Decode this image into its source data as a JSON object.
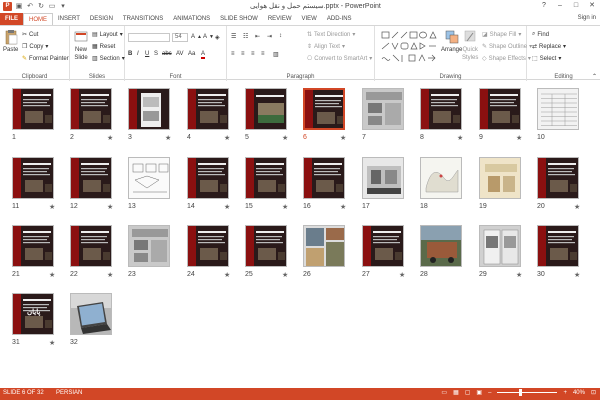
{
  "titlebar": {
    "title": "سیستم حمل و نقل هوایی.pptx - PowerPoint",
    "logo": "P",
    "controls": [
      "?",
      "–",
      "□",
      "✕"
    ]
  },
  "tabs": [
    {
      "label": "FILE"
    },
    {
      "label": "HOME"
    },
    {
      "label": "INSERT"
    },
    {
      "label": "DESIGN"
    },
    {
      "label": "TRANSITIONS"
    },
    {
      "label": "ANIMATIONS"
    },
    {
      "label": "SLIDE SHOW"
    },
    {
      "label": "REVIEW"
    },
    {
      "label": "VIEW"
    },
    {
      "label": "ADD-INS"
    }
  ],
  "signin": "Sign in",
  "ribbon": {
    "clipboard": {
      "label": "Clipboard",
      "paste": "Paste",
      "cut": "Cut",
      "copy": "Copy",
      "format_painter": "Format Painter"
    },
    "slides": {
      "label": "Slides",
      "new_slide": "New",
      "new_slide2": "Slide",
      "layout": "Layout",
      "reset": "Reset",
      "section": "Section"
    },
    "font": {
      "label": "Font",
      "size": "54"
    },
    "paragraph": {
      "label": "Paragraph",
      "text_direction": "Text Direction",
      "align_text": "Align Text",
      "convert_smartart": "Convert to SmartArt"
    },
    "drawing": {
      "label": "Drawing",
      "arrange": "Arrange",
      "quick_styles": "Quick",
      "quick_styles2": "Styles",
      "shape_fill": "Shape Fill",
      "shape_outline": "Shape Outline",
      "shape_effects": "Shape Effects"
    },
    "editing": {
      "label": "Editing",
      "find": "Find",
      "replace": "Replace",
      "select": "Select"
    }
  },
  "slides": [
    {
      "n": "1",
      "star": false
    },
    {
      "n": "2",
      "star": true
    },
    {
      "n": "3",
      "star": true
    },
    {
      "n": "4",
      "star": true
    },
    {
      "n": "5",
      "star": true
    },
    {
      "n": "6",
      "star": true
    },
    {
      "n": "7",
      "star": false
    },
    {
      "n": "8",
      "star": true
    },
    {
      "n": "9",
      "star": true
    },
    {
      "n": "10",
      "star": false
    },
    {
      "n": "11",
      "star": true
    },
    {
      "n": "12",
      "star": true
    },
    {
      "n": "13",
      "star": false
    },
    {
      "n": "14",
      "star": true
    },
    {
      "n": "15",
      "star": true
    },
    {
      "n": "16",
      "star": true
    },
    {
      "n": "17",
      "star": false
    },
    {
      "n": "18",
      "star": false
    },
    {
      "n": "19",
      "star": false
    },
    {
      "n": "20",
      "star": true
    },
    {
      "n": "21",
      "star": true
    },
    {
      "n": "22",
      "star": true
    },
    {
      "n": "23",
      "star": false
    },
    {
      "n": "24",
      "star": true
    },
    {
      "n": "25",
      "star": true
    },
    {
      "n": "26",
      "star": false
    },
    {
      "n": "27",
      "star": true
    },
    {
      "n": "28",
      "star": false
    },
    {
      "n": "29",
      "star": true
    },
    {
      "n": "30",
      "star": true
    },
    {
      "n": "31",
      "star": true
    },
    {
      "n": "32",
      "star": false
    }
  ],
  "slide_texts": {
    "s31": "پایان"
  },
  "statusbar": {
    "slide_info": "SLIDE 6 OF 32",
    "language": "PERSIAN",
    "zoom": "40%"
  },
  "colors": {
    "accent": "#d24726",
    "dark_slide": "#2a1a1a",
    "red_band": "#8b1010"
  }
}
